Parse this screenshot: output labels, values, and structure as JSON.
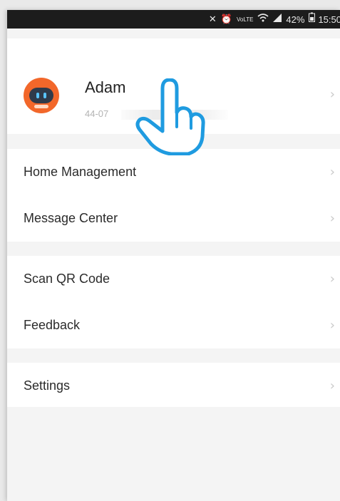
{
  "status_bar": {
    "icons": [
      "mute-icon",
      "alarm-icon",
      "volte-icon",
      "wifi-icon",
      "signal-icon",
      "battery-icon"
    ],
    "volte_text": "VoLTE",
    "battery_percent": "42%",
    "time": "15:50"
  },
  "profile": {
    "name": "Adam",
    "id_prefix": "44-07",
    "chevron": "›"
  },
  "menu": {
    "group1": [
      {
        "label": "Home Management",
        "chevron": "›"
      },
      {
        "label": "Message Center",
        "chevron": "›"
      }
    ],
    "group2": [
      {
        "label": "Scan QR Code",
        "chevron": "›"
      },
      {
        "label": "Feedback",
        "chevron": "›"
      }
    ],
    "group3": [
      {
        "label": "Settings",
        "chevron": "›"
      }
    ]
  },
  "colors": {
    "accent_avatar": "#f2672a",
    "hand_outline": "#1f9be0"
  }
}
